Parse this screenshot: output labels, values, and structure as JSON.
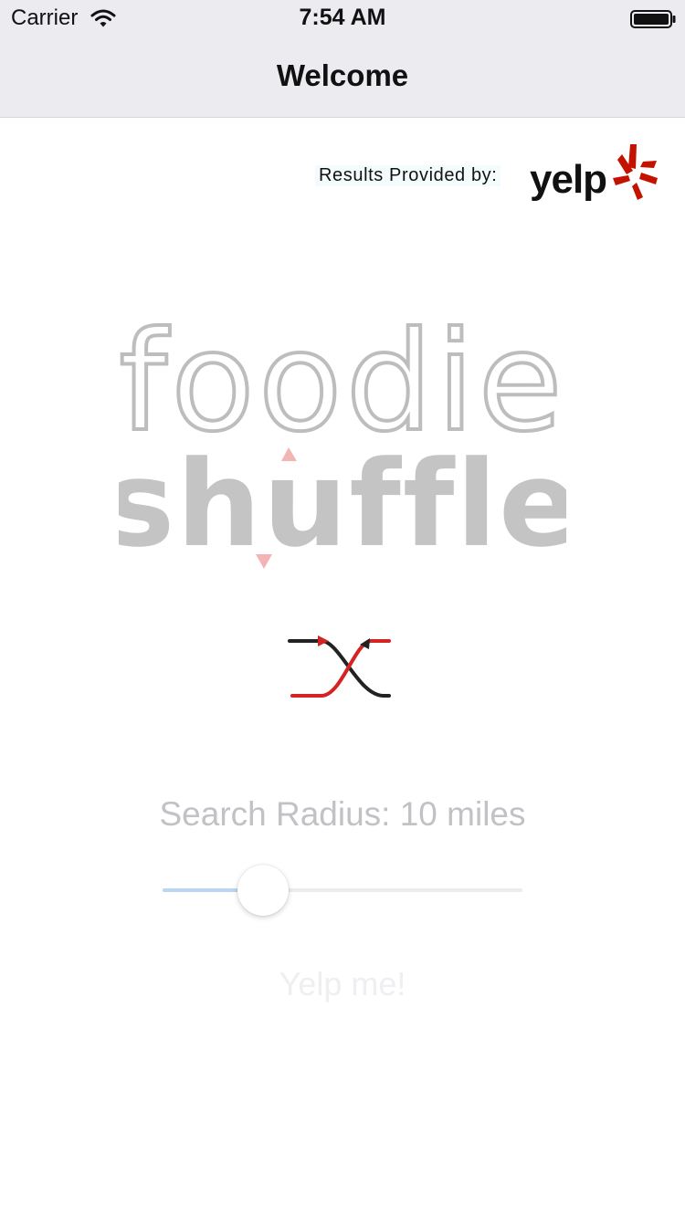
{
  "status_bar": {
    "carrier": "Carrier",
    "time": "7:54 AM",
    "wifi_icon": "wifi-icon",
    "battery_icon": "battery-icon"
  },
  "nav": {
    "title": "Welcome"
  },
  "attribution": {
    "label": "Results Provided by:",
    "logo_text": "yelp",
    "logo_icon": "yelp-burst-icon"
  },
  "app_logo": {
    "line1": "foodie",
    "line2": "shuffle"
  },
  "shuffle_icon": "shuffle-arrows-icon",
  "search": {
    "label": "Search Radius: 10 miles",
    "radius_value": 10,
    "radius_unit": "miles",
    "slider_fraction": 0.28
  },
  "actions": {
    "submit_label": "Yelp me!"
  },
  "colors": {
    "nav_background": "#ebebf0",
    "slider_fill": "#b9d6f2",
    "logo_gray": "#bdbdbd",
    "accent_red": "#d32323",
    "yelp_red": "#c41200"
  }
}
